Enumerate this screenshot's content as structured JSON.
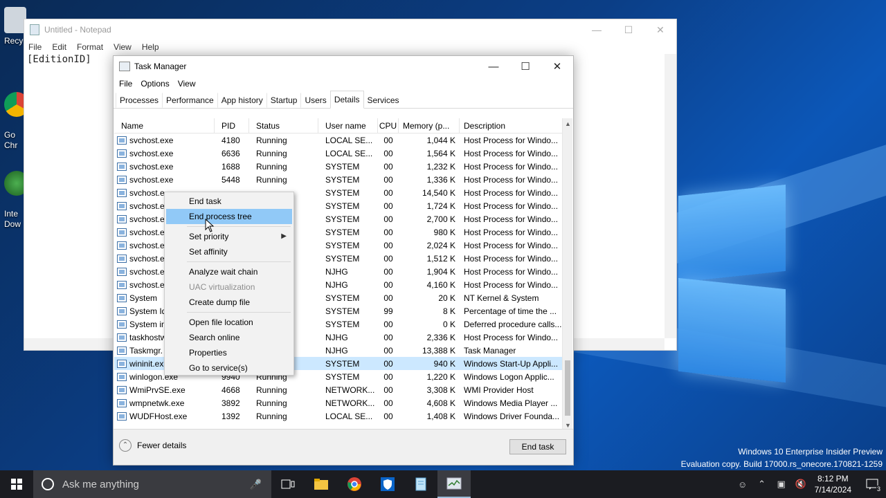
{
  "desktop": {
    "icons": [
      {
        "label": "Recy",
        "icon": "recycle-bin-icon"
      },
      {
        "label": "Go\nChr",
        "icon": "chrome-icon"
      },
      {
        "label": "Inte\nDow",
        "icon": "internet-download-manager-icon"
      }
    ],
    "watermark_line1": "Windows 10 Enterprise Insider Preview",
    "watermark_line2": "Evaluation copy. Build 17000.rs_onecore.170821-1259"
  },
  "notepad": {
    "title": "Untitled - Notepad",
    "menu": [
      "File",
      "Edit",
      "Format",
      "View",
      "Help"
    ],
    "text": "[EditionID]"
  },
  "taskmanager": {
    "title": "Task Manager",
    "menu": [
      "File",
      "Options",
      "View"
    ],
    "tabs": [
      "Processes",
      "Performance",
      "App history",
      "Startup",
      "Users",
      "Details",
      "Services"
    ],
    "active_tab": "Details",
    "columns": [
      "Name",
      "PID",
      "Status",
      "User name",
      "CPU",
      "Memory (p...",
      "Description"
    ],
    "rows": [
      {
        "name": "svchost.exe",
        "pid": "4180",
        "status": "Running",
        "user": "LOCAL SE...",
        "cpu": "00",
        "mem": "1,044 K",
        "desc": "Host Process for Windo..."
      },
      {
        "name": "svchost.exe",
        "pid": "6636",
        "status": "Running",
        "user": "LOCAL SE...",
        "cpu": "00",
        "mem": "1,564 K",
        "desc": "Host Process for Windo..."
      },
      {
        "name": "svchost.exe",
        "pid": "1688",
        "status": "Running",
        "user": "SYSTEM",
        "cpu": "00",
        "mem": "1,232 K",
        "desc": "Host Process for Windo..."
      },
      {
        "name": "svchost.exe",
        "pid": "5448",
        "status": "Running",
        "user": "SYSTEM",
        "cpu": "00",
        "mem": "1,336 K",
        "desc": "Host Process for Windo..."
      },
      {
        "name": "svchost.e",
        "pid": "",
        "status": "",
        "user": "SYSTEM",
        "cpu": "00",
        "mem": "14,540 K",
        "desc": "Host Process for Windo..."
      },
      {
        "name": "svchost.e",
        "pid": "",
        "status": "",
        "user": "SYSTEM",
        "cpu": "00",
        "mem": "1,724 K",
        "desc": "Host Process for Windo..."
      },
      {
        "name": "svchost.e",
        "pid": "",
        "status": "",
        "user": "SYSTEM",
        "cpu": "00",
        "mem": "2,700 K",
        "desc": "Host Process for Windo..."
      },
      {
        "name": "svchost.e",
        "pid": "",
        "status": "",
        "user": "SYSTEM",
        "cpu": "00",
        "mem": "980 K",
        "desc": "Host Process for Windo..."
      },
      {
        "name": "svchost.e",
        "pid": "",
        "status": "",
        "user": "SYSTEM",
        "cpu": "00",
        "mem": "2,024 K",
        "desc": "Host Process for Windo..."
      },
      {
        "name": "svchost.e",
        "pid": "",
        "status": "",
        "user": "SYSTEM",
        "cpu": "00",
        "mem": "1,512 K",
        "desc": "Host Process for Windo..."
      },
      {
        "name": "svchost.e",
        "pid": "",
        "status": "",
        "user": "NJHG",
        "cpu": "00",
        "mem": "1,904 K",
        "desc": "Host Process for Windo..."
      },
      {
        "name": "svchost.e",
        "pid": "",
        "status": "",
        "user": "NJHG",
        "cpu": "00",
        "mem": "4,160 K",
        "desc": "Host Process for Windo..."
      },
      {
        "name": "System",
        "pid": "",
        "status": "",
        "user": "SYSTEM",
        "cpu": "00",
        "mem": "20 K",
        "desc": "NT Kernel & System"
      },
      {
        "name": "System Id",
        "pid": "",
        "status": "",
        "user": "SYSTEM",
        "cpu": "99",
        "mem": "8 K",
        "desc": "Percentage of time the ..."
      },
      {
        "name": "System in",
        "pid": "",
        "status": "",
        "user": "SYSTEM",
        "cpu": "00",
        "mem": "0 K",
        "desc": "Deferred procedure calls..."
      },
      {
        "name": "taskhostw",
        "pid": "",
        "status": "",
        "user": "NJHG",
        "cpu": "00",
        "mem": "2,336 K",
        "desc": "Host Process for Windo..."
      },
      {
        "name": "Taskmgr.",
        "pid": "",
        "status": "",
        "user": "NJHG",
        "cpu": "00",
        "mem": "13,388 K",
        "desc": "Task Manager"
      },
      {
        "name": "wininit.ex",
        "pid": "",
        "status": "",
        "user": "SYSTEM",
        "cpu": "00",
        "mem": "940 K",
        "desc": "Windows Start-Up Appli...",
        "selected": true
      },
      {
        "name": "winlogon.exe",
        "pid": "9940",
        "status": "Running",
        "user": "SYSTEM",
        "cpu": "00",
        "mem": "1,220 K",
        "desc": "Windows Logon Applic..."
      },
      {
        "name": "WmiPrvSE.exe",
        "pid": "4668",
        "status": "Running",
        "user": "NETWORK...",
        "cpu": "00",
        "mem": "3,308 K",
        "desc": "WMI Provider Host"
      },
      {
        "name": "wmpnetwk.exe",
        "pid": "3892",
        "status": "Running",
        "user": "NETWORK...",
        "cpu": "00",
        "mem": "4,608 K",
        "desc": "Windows Media Player ..."
      },
      {
        "name": "WUDFHost.exe",
        "pid": "1392",
        "status": "Running",
        "user": "LOCAL SE...",
        "cpu": "00",
        "mem": "1,408 K",
        "desc": "Windows Driver Founda..."
      }
    ],
    "fewer_details": "Fewer details",
    "end_task_button": "End task"
  },
  "context_menu": {
    "items": [
      {
        "label": "End task",
        "type": "item"
      },
      {
        "label": "End process tree",
        "type": "item",
        "highlighted": true
      },
      {
        "type": "separator"
      },
      {
        "label": "Set priority",
        "type": "item",
        "submenu": true
      },
      {
        "label": "Set affinity",
        "type": "item"
      },
      {
        "type": "separator"
      },
      {
        "label": "Analyze wait chain",
        "type": "item"
      },
      {
        "label": "UAC virtualization",
        "type": "item",
        "disabled": true
      },
      {
        "label": "Create dump file",
        "type": "item"
      },
      {
        "type": "separator"
      },
      {
        "label": "Open file location",
        "type": "item"
      },
      {
        "label": "Search online",
        "type": "item"
      },
      {
        "label": "Properties",
        "type": "item"
      },
      {
        "label": "Go to service(s)",
        "type": "item"
      }
    ]
  },
  "taskbar": {
    "search_placeholder": "Ask me anything",
    "apps": [
      "task-view-icon",
      "file-explorer-icon",
      "chrome-icon",
      "security-shield-icon",
      "notepad-icon",
      "task-manager-icon"
    ],
    "time": "8:12 PM",
    "date": "7/14/2024",
    "notification_count": "3"
  }
}
